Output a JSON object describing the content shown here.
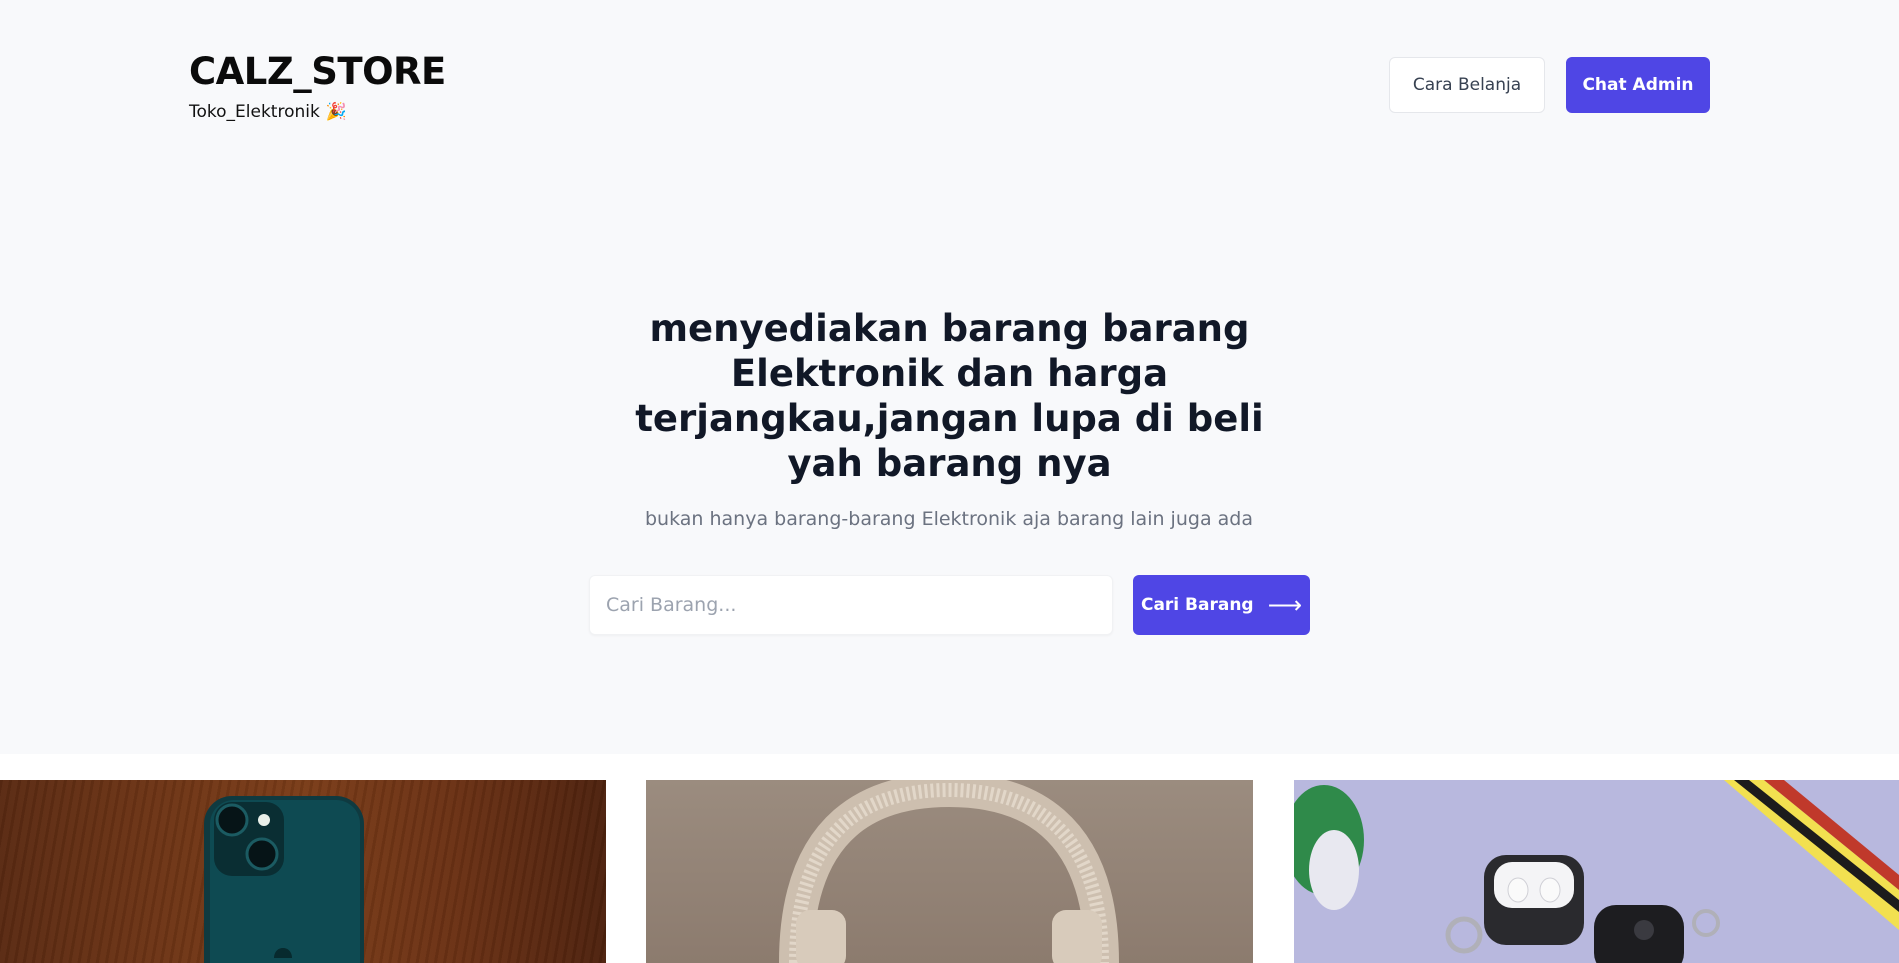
{
  "header": {
    "brand_title": "CALZ_STORE",
    "brand_subtitle": "Toko_Elektronik",
    "brand_emoji": "🎉",
    "how_to_shop_label": "Cara Belanja",
    "chat_admin_label": "Chat Admin"
  },
  "hero": {
    "headline": "menyediakan barang barang Elektronik dan harga terjangkau,jangan lupa di beli yah barang nya",
    "subheadline": "bukan hanya barang-barang Elektronik aja barang lain juga ada"
  },
  "search": {
    "placeholder": "Cari Barang...",
    "value": "",
    "button_label": "Cari Barang",
    "button_icon": "arrow-right-icon"
  },
  "gallery": [
    {
      "name": "smartphone-photo"
    },
    {
      "name": "headphones-photo"
    },
    {
      "name": "earbuds-case-photo"
    }
  ],
  "colors": {
    "primary": "#4f46e5",
    "hero_background": "#f8f9fb",
    "heading": "#111827",
    "muted": "#6b7280"
  }
}
